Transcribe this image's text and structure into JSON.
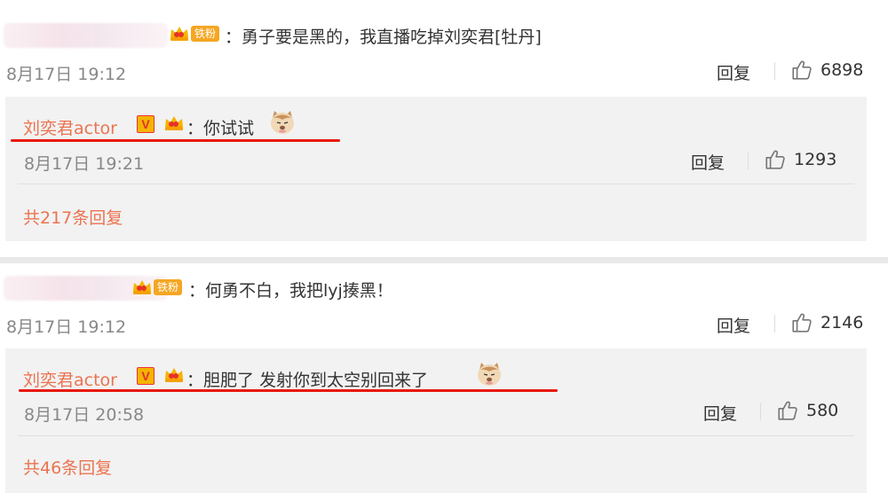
{
  "comments": [
    {
      "fan_badge": "铁粉",
      "crown_level": "4",
      "text": "：勇子要是黑的，我直播吃掉刘奕君[牡丹]",
      "time": "8月17日 19:12",
      "reply_label": "回复",
      "likes": "6898",
      "reply": {
        "author": "刘奕君actor",
        "text": "：你试试",
        "time": "8月17日 19:21",
        "reply_label": "回复",
        "likes": "1293"
      },
      "more_replies": "共217条回复"
    },
    {
      "fan_badge": "铁粉",
      "crown_level": "6",
      "text": "：何勇不白，我把lyj揍黑！",
      "time": "8月17日 19:12",
      "reply_label": "回复",
      "likes": "2146",
      "reply": {
        "author": "刘奕君actor",
        "text": "：胆肥了 发射你到太空别回来了",
        "time": "8月17日 20:58",
        "reply_label": "回复",
        "likes": "580"
      },
      "more_replies": "共46条回复"
    }
  ],
  "vip_badge": "V",
  "colors": {
    "author": "#eb7350",
    "highlight_line": "#e8180c",
    "fan_badge": "#f5a623"
  }
}
